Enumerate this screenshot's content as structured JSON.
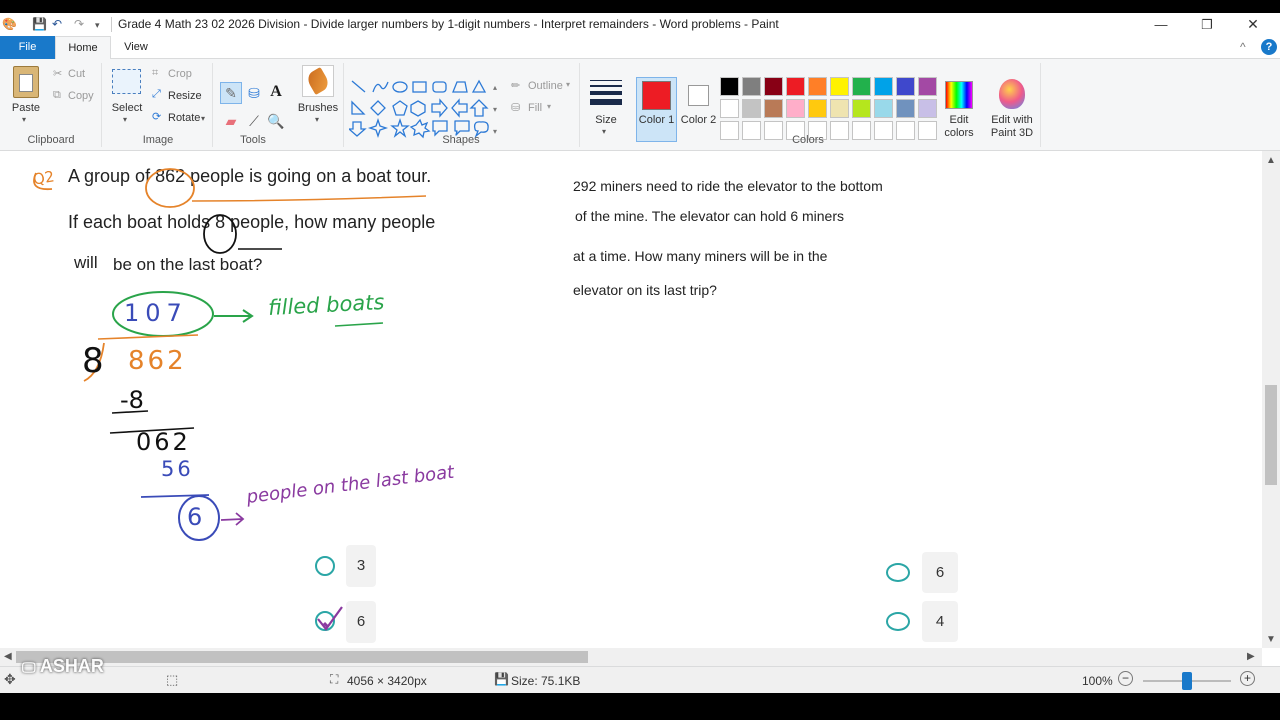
{
  "window": {
    "title": "Grade 4 Math 23 02 2026 Division - Divide larger numbers by 1-digit numbers - Interpret remainders - Word problems - Paint",
    "minimize": "—",
    "restore": "❐",
    "close": "✕"
  },
  "menu": {
    "file": "File",
    "home": "Home",
    "view": "View",
    "collapse": "^",
    "help": "?"
  },
  "ribbon": {
    "clipboard": {
      "label": "Clipboard",
      "paste": "Paste",
      "cut": "Cut",
      "copy": "Copy"
    },
    "image": {
      "label": "Image",
      "select": "Select",
      "crop": "Crop",
      "resize": "Resize",
      "rotate": "Rotate"
    },
    "tools": {
      "label": "Tools"
    },
    "brushes": {
      "label": "Brushes"
    },
    "shapes": {
      "label": "Shapes",
      "outline": "Outline",
      "fill": "Fill"
    },
    "size": {
      "label": "Size"
    },
    "colors": {
      "label": "Colors",
      "color1": "Color 1",
      "color2": "Color 2",
      "color1_value": "#ed1c24",
      "color2_value": "#ffffff",
      "edit_colors": "Edit colors",
      "edit_paint3d": "Edit with Paint 3D",
      "palette_row1": [
        "#000000",
        "#7f7f7f",
        "#880015",
        "#ed1c24",
        "#ff7f27",
        "#fff200",
        "#22b14c",
        "#00a2e8",
        "#3f48cc",
        "#a349a4"
      ],
      "palette_row2": [
        "#ffffff",
        "#c3c3c3",
        "#b97a57",
        "#ffaec9",
        "#ffc90e",
        "#efe4b0",
        "#b5e61d",
        "#99d9ea",
        "#7092be",
        "#c8bfe7"
      ]
    }
  },
  "canvas": {
    "left_problem": {
      "line1": "A group of 862 people is going on a boat tour.",
      "line2": "If each boat holds 8 people, how many people",
      "line3a": "will",
      "line3b": "be on the last boat?"
    },
    "handwriting": {
      "q_label": "Q2",
      "quotient": "107",
      "filled_boats": "filled boats",
      "divisor": "8",
      "dividend": "862",
      "step1": "-8",
      "step2": "062",
      "step3": "56",
      "remainder": "6",
      "last_boat": "people on the last boat"
    },
    "right_problem": {
      "line1": "292 miners need to ride the elevator to the bottom",
      "line2": "of the mine. The elevator can hold 6 miners",
      "line3": "at a time. How many miners will be in the",
      "line4": "elevator on its last trip?"
    },
    "left_options": [
      "3",
      "6"
    ],
    "right_options": [
      "6",
      "4"
    ]
  },
  "status": {
    "dimensions": "4056 × 3420px",
    "size": "Size: 75.1KB",
    "zoom": "100%",
    "zoom_fraction": 0.5,
    "watermark": "ASHAR"
  }
}
